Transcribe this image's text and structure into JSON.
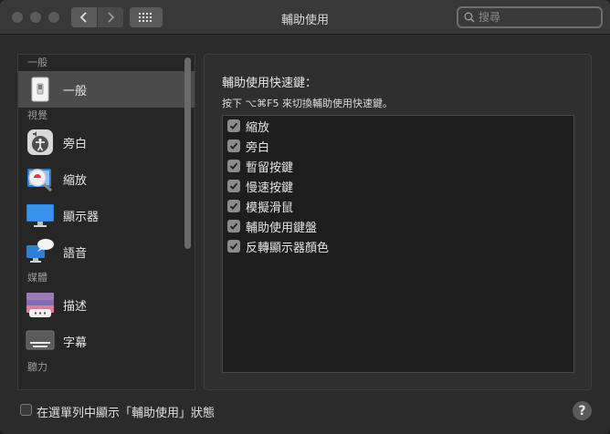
{
  "window": {
    "title": "輔助使用"
  },
  "search": {
    "placeholder": "搜尋"
  },
  "sidebar": {
    "sections": [
      {
        "label": "一般",
        "items": [
          {
            "label": "一般",
            "icon": "general-icon",
            "selected": true
          }
        ]
      },
      {
        "label": "視覺",
        "items": [
          {
            "label": "旁白",
            "icon": "voiceover-icon"
          },
          {
            "label": "縮放",
            "icon": "zoom-icon"
          },
          {
            "label": "顯示器",
            "icon": "display-icon"
          },
          {
            "label": "語音",
            "icon": "speech-icon"
          }
        ]
      },
      {
        "label": "媒體",
        "items": [
          {
            "label": "描述",
            "icon": "descriptions-icon"
          },
          {
            "label": "字幕",
            "icon": "captions-icon"
          }
        ]
      },
      {
        "label": "聽力",
        "items": []
      }
    ]
  },
  "main": {
    "title": "輔助使用快速鍵：",
    "subtitle": "按下 ⌥⌘F5 來切換輔助使用快速鍵。",
    "shortcuts": [
      {
        "label": "縮放",
        "checked": true
      },
      {
        "label": "旁白",
        "checked": true
      },
      {
        "label": "暫留按鍵",
        "checked": true
      },
      {
        "label": "慢速按鍵",
        "checked": true
      },
      {
        "label": "模擬滑鼠",
        "checked": true
      },
      {
        "label": "輔助使用鍵盤",
        "checked": true
      },
      {
        "label": "反轉顯示器顏色",
        "checked": true
      }
    ]
  },
  "footer": {
    "menu_status_label": "在選單列中顯示「輔助使用」狀態",
    "menu_status_checked": false,
    "help_label": "?"
  }
}
